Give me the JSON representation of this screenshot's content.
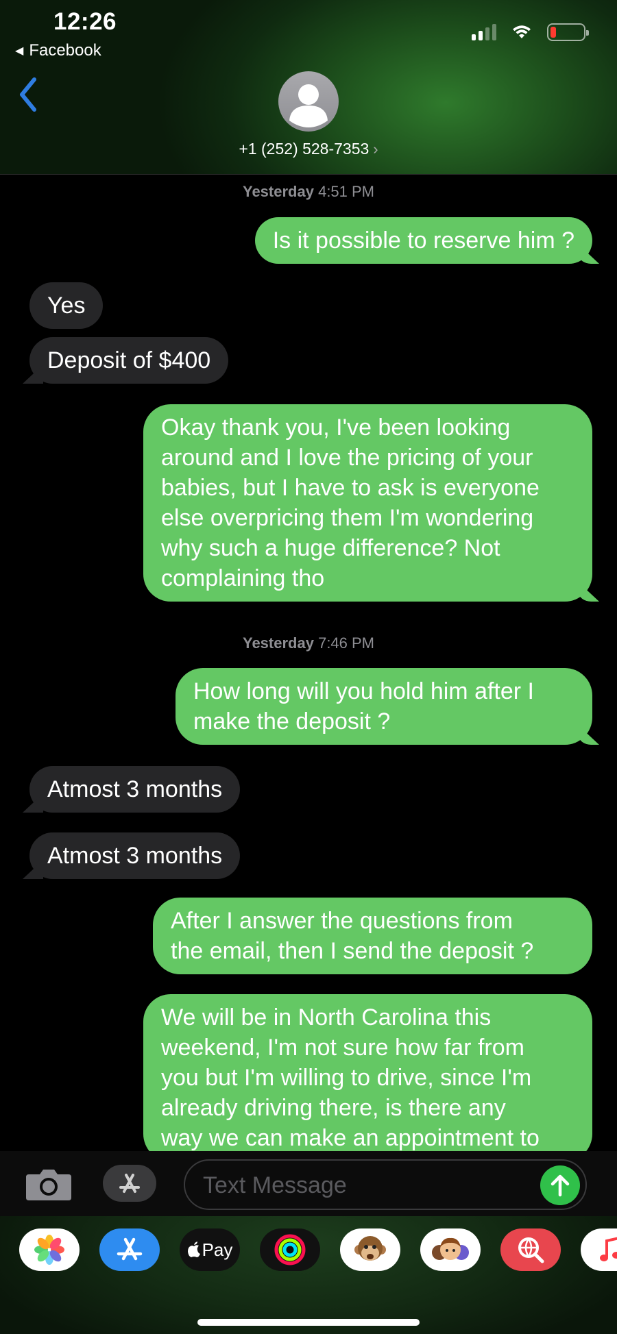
{
  "status_bar": {
    "time": "12:26",
    "back_app": "Facebook",
    "battery_color": "#ff3b30"
  },
  "header": {
    "contact": "+1 (252) 528-7353",
    "accent": "#2f7de1"
  },
  "messages": [
    {
      "type": "timestamp",
      "day": "Yesterday",
      "time": "4:51 PM"
    },
    {
      "type": "sent",
      "lines": [
        "Is it possible to reserve him ?"
      ]
    },
    {
      "type": "received",
      "lines": [
        "Yes"
      ]
    },
    {
      "type": "received",
      "lines": [
        "Deposit of $400"
      ]
    },
    {
      "type": "sent",
      "lines": [
        "Okay thank you, I've been looking",
        "around and I love the pricing of your",
        "babies, but I have to ask is everyone",
        "else overpricing them I'm wondering",
        "why such a huge difference? Not",
        "complaining tho"
      ]
    },
    {
      "type": "timestamp",
      "day": "Yesterday",
      "time": "7:46 PM"
    },
    {
      "type": "sent",
      "lines": [
        "How long will you hold him after I",
        "make the deposit ?"
      ]
    },
    {
      "type": "received",
      "lines": [
        "Atmost 3 months"
      ]
    },
    {
      "type": "received",
      "lines": [
        "Atmost 3 months"
      ]
    },
    {
      "type": "sent",
      "lines": [
        "After I answer the questions from",
        "the email, then I send the deposit ?"
      ]
    },
    {
      "type": "sent",
      "lines": [
        "We will be in North Carolina this",
        "weekend, I'm not sure how far from",
        "you but I'm willing to drive, since I'm",
        "already driving there, is there any",
        "way we can make an appointment to"
      ]
    }
  ],
  "input": {
    "placeholder": "Text Message"
  },
  "app_strip": {
    "apple_pay_label": "Pay",
    "items": [
      "photos-app",
      "app-store-app",
      "apple-pay-app",
      "activity-app",
      "monkey-memoji-app",
      "memoji-app",
      "search-images-app",
      "music-app"
    ]
  },
  "colors": {
    "sent_bubble": "#64c864",
    "received_bubble": "#262628",
    "send_button": "#30c04a"
  }
}
